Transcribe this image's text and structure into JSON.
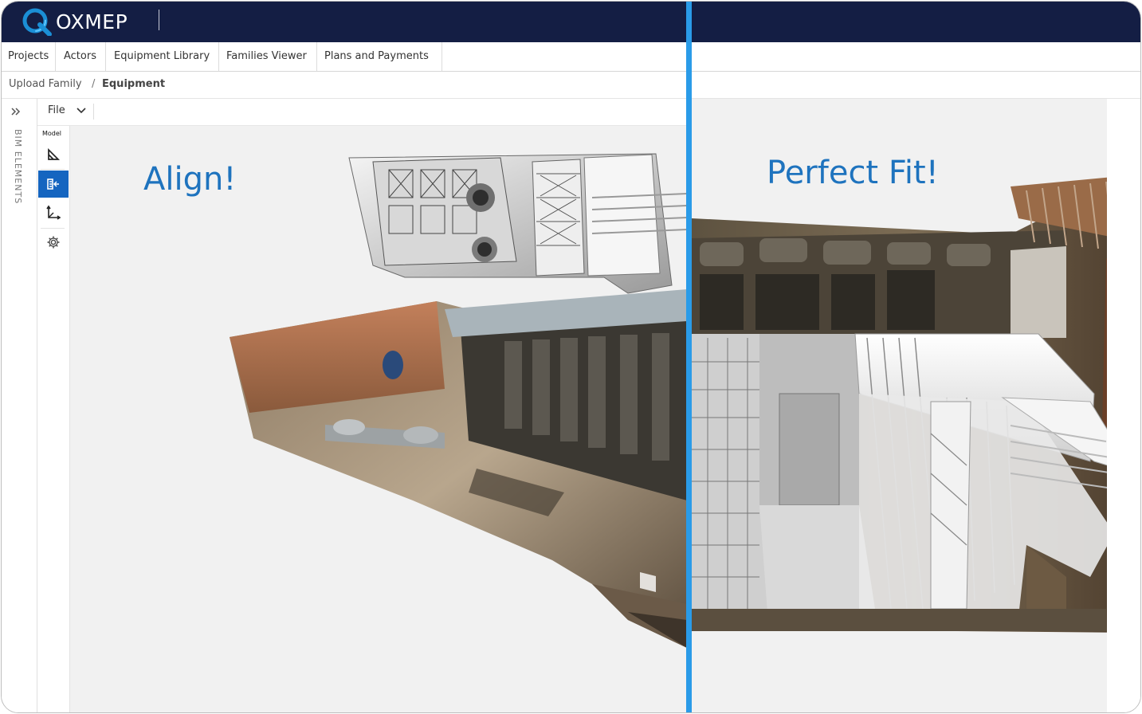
{
  "app": {
    "brand": "OXMEP",
    "logo_icon": "q-logo-icon"
  },
  "nav": {
    "items": [
      {
        "label": "Projects"
      },
      {
        "label": "Actors"
      },
      {
        "label": "Equipment Library"
      },
      {
        "label": "Families Viewer"
      },
      {
        "label": "Plans and Payments"
      }
    ]
  },
  "breadcrumb": {
    "parent": "Upload Family",
    "separator": "/",
    "current": "Equipment"
  },
  "sidebar": {
    "expand_icon": "chevrons-right-icon",
    "label": "BIM ELEMENTS"
  },
  "toolbar": {
    "file_menu": "File"
  },
  "tools": {
    "section_label": "Model",
    "items": [
      {
        "icon": "measure-icon",
        "active": false
      },
      {
        "icon": "align-icon",
        "active": true
      },
      {
        "icon": "axes-icon",
        "active": false
      },
      {
        "icon": "gear-icon",
        "active": false
      }
    ],
    "tooltip": "settings"
  },
  "captions": {
    "left": "Align!",
    "right": "Perfect Fit!"
  },
  "colors": {
    "brand_navy": "#141e44",
    "accent_blue": "#1e73be",
    "divider": "#2a9be8",
    "active_tool": "#1565c0"
  }
}
